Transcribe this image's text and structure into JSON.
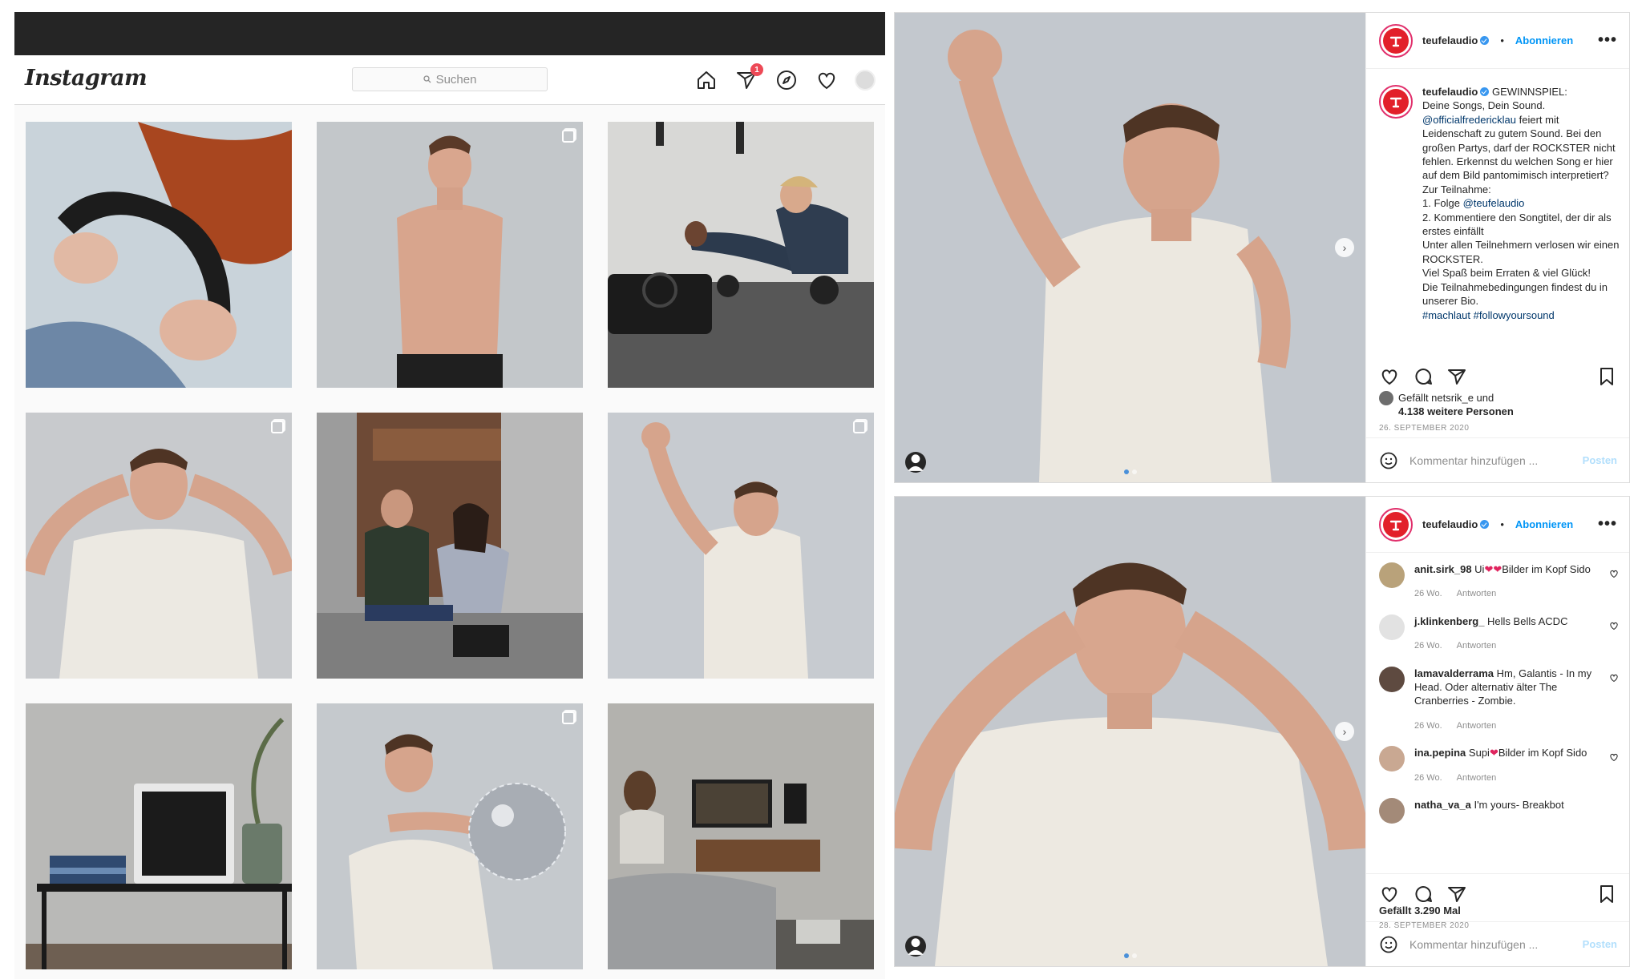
{
  "grid": {
    "logo": "Instagram",
    "search_placeholder": "Suchen",
    "dm_badge": "1",
    "icons": [
      "home-icon",
      "direct-message-icon",
      "explore-compass-icon",
      "activity-heart-icon",
      "profile-avatar"
    ]
  },
  "post1": {
    "handle": "teufelaudio",
    "follow": "Abonnieren",
    "more": "•••",
    "caption": {
      "handle": "teufelaudio",
      "line1": "GEWINNSPIEL:",
      "line2": "Deine Songs, Dein Sound.",
      "mention1": "@officialfredericklau",
      "line3": "feiert mit Leidenschaft zu gutem Sound. Bei den großen Partys, darf der ROCKSTER nicht fehlen. Erkennst du welchen Song er hier auf dem Bild pantomimisch interpretiert?",
      "line4": "Zur Teilnahme:",
      "line5a": "1. Folge",
      "mention2": "@teufelaudio",
      "line6": "2. Kommentiere den Songtitel, der dir als erstes einfällt",
      "line7": "Unter allen Teilnehmern verlosen wir einen ROCKSTER.",
      "line8": "Viel Spaß beim Erraten & viel Glück!",
      "line9": "Die Teilnahmebedingungen findest du in unserer Bio.",
      "tags": "#machlaut #followyoursound"
    },
    "likes_line1": "Gefällt netsrik_e und",
    "likes_line2": "4.138 weitere Personen",
    "date": "26. SEPTEMBER 2020",
    "comment_placeholder": "Kommentar hinzufügen ...",
    "post_button": "Posten"
  },
  "post2": {
    "handle": "teufelaudio",
    "follow": "Abonnieren",
    "more": "•••",
    "comments": [
      {
        "user": "anit.sirk_98",
        "pre": "Ui",
        "hearts": "❤❤",
        "post": "Bilder im Kopf Sido",
        "age": "26 Wo.",
        "reply": "Antworten"
      },
      {
        "user": "j.klinkenberg_",
        "pre": "Hells Bells ACDC",
        "hearts": "",
        "post": "",
        "age": "26 Wo.",
        "reply": "Antworten"
      },
      {
        "user": "lamavalderrama",
        "pre": "Hm, Galantis - In my Head. Oder alternativ älter The Cranberries - Zombie.",
        "hearts": "",
        "post": "",
        "age": "26 Wo.",
        "reply": "Antworten"
      },
      {
        "user": "ina.pepina",
        "pre": "Supi",
        "hearts": "❤",
        "post": "Bilder im Kopf Sido",
        "age": "26 Wo.",
        "reply": "Antworten"
      },
      {
        "user": "natha_va_a",
        "pre": "I'm yours- Breakbot",
        "hearts": "",
        "post": "",
        "age": "",
        "reply": ""
      }
    ],
    "likes": "Gefällt 3.290 Mal",
    "date": "28. SEPTEMBER 2020",
    "comment_placeholder": "Kommentar hinzufügen ...",
    "post_button": "Posten"
  },
  "colors": {
    "accent_blue": "#0095f6",
    "brand_red": "#e2202a",
    "badge_red": "#ed4956"
  }
}
